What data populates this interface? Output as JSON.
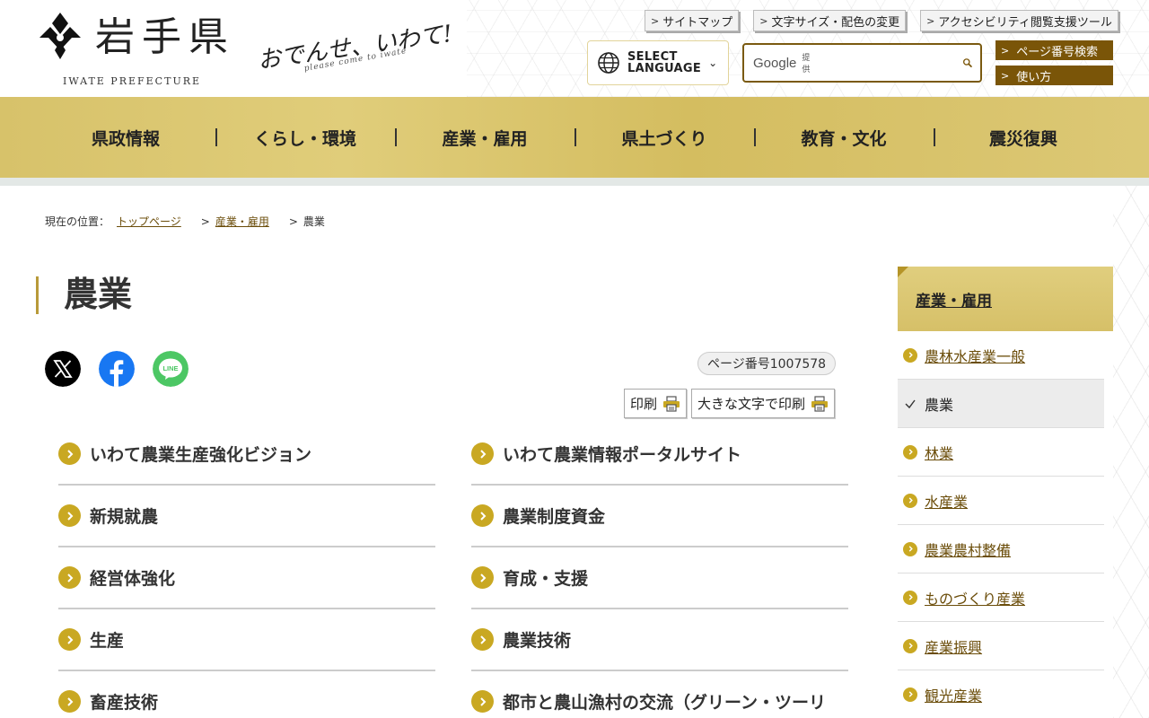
{
  "header": {
    "logo_title": "岩手県",
    "logo_sub": "IWATE PREFECTURE",
    "tagline": "おでんせ、いわて!",
    "tagline_sub": "please come to iwate",
    "util_links": [
      "サイトマップ",
      "文字サイズ・配色の変更",
      "アクセシビリティ閲覧支援ツール"
    ],
    "language": {
      "line1": "SELECT",
      "line2": "LANGUAGE"
    },
    "search": {
      "brand": "Google",
      "brand_sub": "提供",
      "value": ""
    },
    "page_tools": [
      "ページ番号検索",
      "使い方"
    ]
  },
  "gnav": [
    "県政情報",
    "くらし・環境",
    "産業・雇用",
    "県土づくり",
    "教育・文化",
    "震災復興"
  ],
  "breadcrumb": {
    "label": "現在の位置：",
    "items": [
      "トップページ",
      "産業・雇用",
      "農業"
    ],
    "separator": ">"
  },
  "main": {
    "title": "農業",
    "page_number": "ページ番号1007578",
    "print": "印刷",
    "print_large": "大きな文字で印刷",
    "links": [
      [
        "いわて農業生産強化ビジョン",
        "いわて農業情報ポータルサイト"
      ],
      [
        "新規就農",
        "農業制度資金"
      ],
      [
        "経営体強化",
        "育成・支援"
      ],
      [
        "生産",
        "農業技術"
      ],
      [
        "畜産技術",
        "都市と農山漁村の交流（グリーン・ツーリ"
      ]
    ]
  },
  "sidenav": {
    "heading": "産業・雇用",
    "items": [
      "農林水産業一般",
      "農業",
      "林業",
      "水産業",
      "農業農村整備",
      "ものづくり産業",
      "産業振興",
      "観光産業"
    ],
    "current_index": 1
  },
  "colors": {
    "gold": "#c9a822",
    "nav_gold": "#d7c26a",
    "brown": "#7a5508",
    "link_brown": "#6b4d0a",
    "x_black": "#000000",
    "facebook_blue": "#1877f2",
    "line_green": "#4cc764"
  },
  "icons": {
    "search": "search-icon",
    "globe": "globe-icon",
    "printer": "printer-icon",
    "x": "x-logo-icon",
    "facebook": "facebook-logo-icon",
    "line": "line-logo-icon"
  }
}
